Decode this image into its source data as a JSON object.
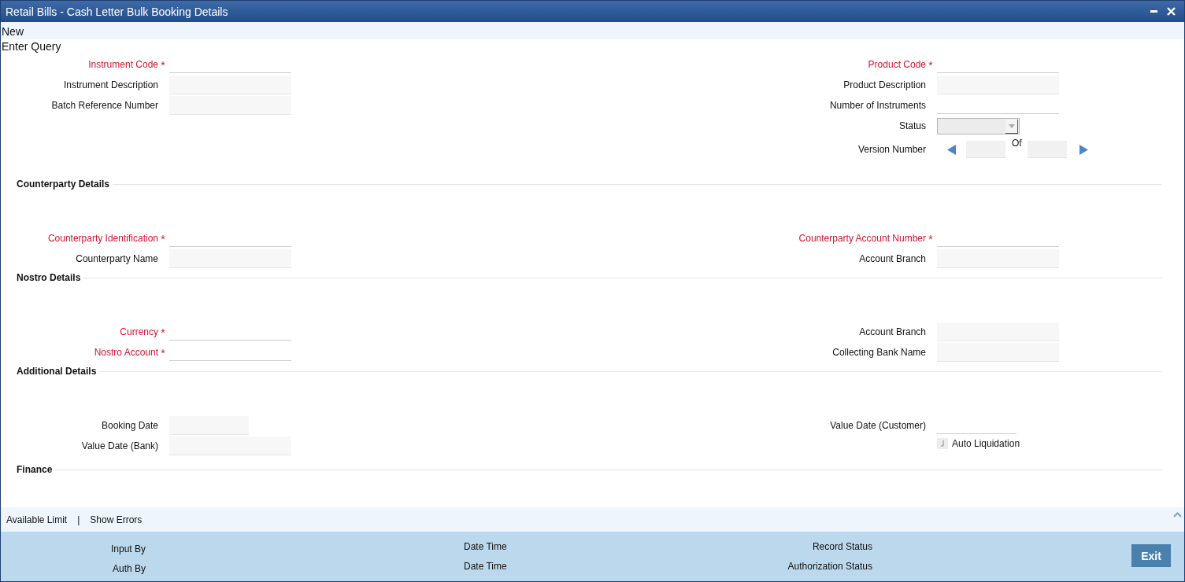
{
  "window": {
    "title": "Retail Bills - Cash Letter Bulk Booking Details"
  },
  "menu": [
    {
      "label": "New"
    },
    {
      "label": "Enter Query"
    }
  ],
  "header": {
    "left": [
      {
        "kind": "input",
        "label": "Instrument Code",
        "required_mark": "*"
      },
      {
        "kind": "display",
        "label": "Instrument Description"
      },
      {
        "kind": "display",
        "label": "Batch Reference Number"
      }
    ],
    "right": [
      {
        "kind": "input",
        "label": "Product Code",
        "required_mark": "*"
      },
      {
        "kind": "display",
        "label": "Product Description"
      },
      {
        "kind": "input",
        "label": "Number of Instruments"
      },
      {
        "kind": "select",
        "label": "Status"
      },
      {
        "kind": "version",
        "label": "Version Number",
        "of": "Of"
      }
    ]
  },
  "sections": [
    {
      "title": "Counterparty Details",
      "left": [
        {
          "kind": "input",
          "label": "Counterparty Identification",
          "required_mark": "*"
        },
        {
          "kind": "display",
          "label": "Counterparty Name"
        }
      ],
      "right": [
        {
          "kind": "input",
          "label": "Counterparty Account Number",
          "required_mark": "*"
        },
        {
          "kind": "display",
          "label": "Account Branch"
        }
      ]
    },
    {
      "title": "Nostro Details",
      "left": [
        {
          "kind": "input",
          "label": "Currency",
          "required_mark": "*"
        },
        {
          "kind": "input",
          "label": "Nostro Account",
          "required_mark": "*"
        }
      ],
      "right": [
        {
          "kind": "display",
          "label": "Account Branch"
        },
        {
          "kind": "display",
          "label": "Collecting Bank Name"
        }
      ]
    },
    {
      "title": "Additional Details",
      "left": [
        {
          "kind": "short_display",
          "label": "Booking Date"
        },
        {
          "kind": "display",
          "label": "Value Date (Bank)"
        }
      ],
      "right": [
        {
          "kind": "short_input",
          "label": "Value Date (Customer)"
        },
        {
          "kind": "checkbox",
          "label": "Auto Liquidation",
          "checked": false
        }
      ]
    },
    {
      "title": "Finance"
    }
  ],
  "footer_links": {
    "items": [
      "Available Limit",
      "Show Errors"
    ],
    "separator": "|"
  },
  "audit": [
    [
      "Input By",
      "Auth By"
    ],
    [
      "Date Time",
      "Date Time"
    ],
    [
      "Record Status",
      "Authorization Status"
    ]
  ],
  "exit_button": "Exit"
}
